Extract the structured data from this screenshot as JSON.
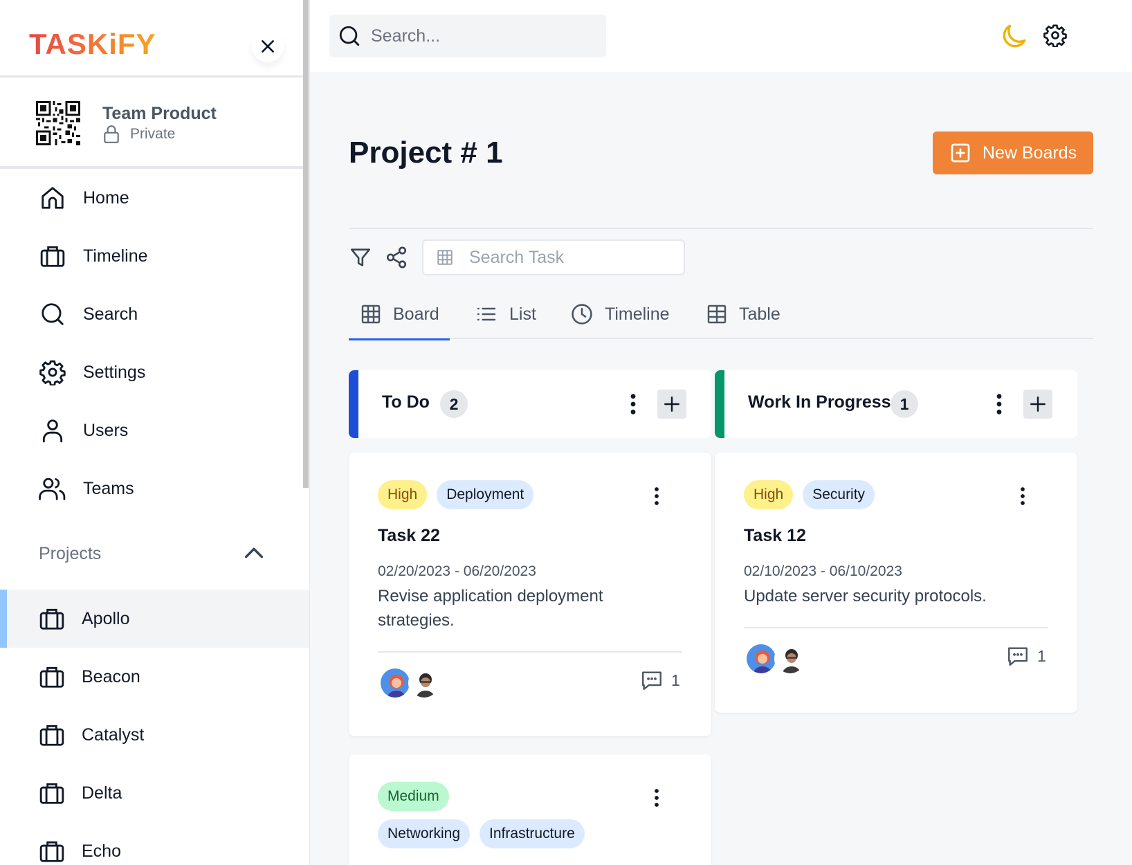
{
  "brand": {
    "name": "TASKiFY"
  },
  "team": {
    "name": "Team Product",
    "visibility": "Private"
  },
  "nav": [
    {
      "label": "Home",
      "icon": "home-icon"
    },
    {
      "label": "Timeline",
      "icon": "briefcase-icon"
    },
    {
      "label": "Search",
      "icon": "search-icon"
    },
    {
      "label": "Settings",
      "icon": "gear-icon"
    },
    {
      "label": "Users",
      "icon": "user-icon"
    },
    {
      "label": "Teams",
      "icon": "users-icon"
    }
  ],
  "projects": {
    "heading": "Projects",
    "items": [
      {
        "label": "Apollo",
        "active": true
      },
      {
        "label": "Beacon",
        "active": false
      },
      {
        "label": "Catalyst",
        "active": false
      },
      {
        "label": "Delta",
        "active": false
      },
      {
        "label": "Echo",
        "active": false
      }
    ]
  },
  "topbar": {
    "search_placeholder": "Search..."
  },
  "page": {
    "title": "Project # 1",
    "new_button": "New Boards"
  },
  "toolbar": {
    "task_search_placeholder": "Search Task"
  },
  "tabs": [
    {
      "label": "Board",
      "active": true
    },
    {
      "label": "List",
      "active": false
    },
    {
      "label": "Timeline",
      "active": false
    },
    {
      "label": "Table",
      "active": false
    }
  ],
  "columns": [
    {
      "title": "To Do",
      "count": "2",
      "color": "#1d4ed8",
      "cards": [
        {
          "priority": "High",
          "tags": [
            "Deployment"
          ],
          "title": "Task 22",
          "dates": "02/20/2023 - 06/20/2023",
          "description": "Revise application deployment strategies.",
          "comments": "1"
        },
        {
          "priority": "Medium",
          "tags": [
            "Networking",
            "Infrastructure"
          ]
        }
      ]
    },
    {
      "title": "Work In Progress",
      "count": "1",
      "color": "#059669",
      "cards": [
        {
          "priority": "High",
          "tags": [
            "Security"
          ],
          "title": "Task 12",
          "dates": "02/10/2023 - 06/10/2023",
          "description": "Update server security protocols.",
          "comments": "1"
        }
      ]
    }
  ],
  "colors": {
    "accent": "#f08335",
    "active_tab": "#2563eb",
    "moon": "#eab308"
  }
}
